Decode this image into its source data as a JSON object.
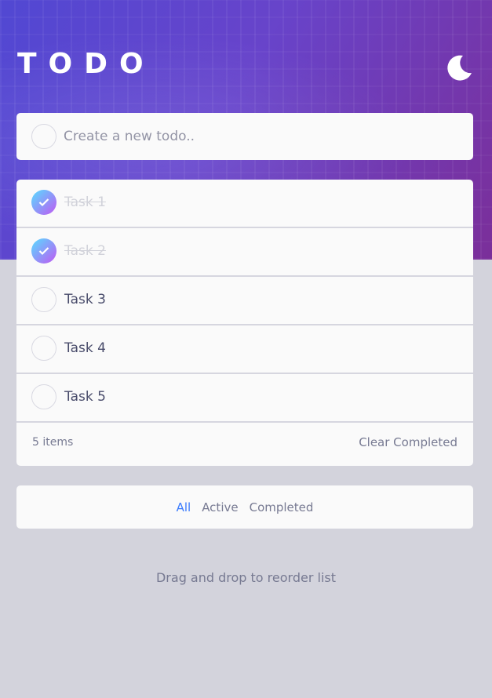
{
  "app": {
    "title": "TODO"
  },
  "header": {
    "theme_toggle_icon": "moon-icon"
  },
  "new_todo": {
    "placeholder": "Create a new todo..",
    "value": ""
  },
  "todos": [
    {
      "label": "Task 1",
      "completed": true
    },
    {
      "label": "Task 2",
      "completed": true
    },
    {
      "label": "Task 3",
      "completed": false
    },
    {
      "label": "Task 4",
      "completed": false
    },
    {
      "label": "Task 5",
      "completed": false
    }
  ],
  "list_footer": {
    "items_left": "5 items",
    "clear_label": "Clear Completed"
  },
  "filters": {
    "all": "All",
    "active": "Active",
    "completed": "Completed",
    "selected": "all"
  },
  "hint": "Drag and drop to reorder list",
  "colors": {
    "accent": "#3a7bfd",
    "check_gradient_start": "#57ddff",
    "check_gradient_end": "#c058f3",
    "background": "#d3d3dc",
    "card": "#fafafa"
  }
}
